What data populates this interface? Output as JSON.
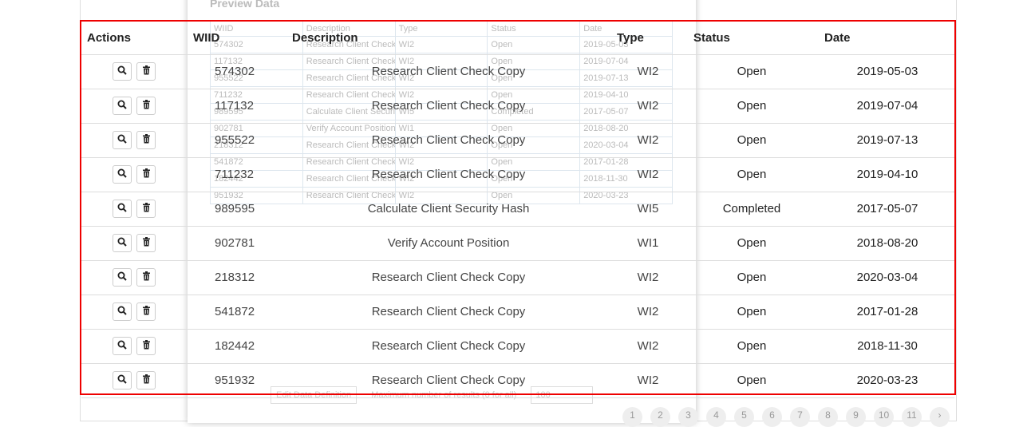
{
  "modal": {
    "title": "Preview Data",
    "columns": [
      "WIID",
      "Description",
      "Type",
      "Status",
      "Date"
    ],
    "rows": [
      [
        "574302",
        "Research Client Check Copy",
        "WI2",
        "Open",
        "2019-05-03"
      ],
      [
        "117132",
        "Research Client Check Copy",
        "WI2",
        "Open",
        "2019-07-04"
      ],
      [
        "955522",
        "Research Client Check Copy",
        "WI2",
        "Open",
        "2019-07-13"
      ],
      [
        "711232",
        "Research Client Check Copy",
        "WI2",
        "Open",
        "2019-04-10"
      ],
      [
        "989595",
        "Calculate Client Security Hash",
        "WI5",
        "Completed",
        "2017-05-07"
      ],
      [
        "902781",
        "Verify Account Position",
        "WI1",
        "Open",
        "2018-08-20"
      ],
      [
        "218312",
        "Research Client Check Copy",
        "WI2",
        "Open",
        "2020-03-04"
      ],
      [
        "541872",
        "Research Client Check Copy",
        "WI2",
        "Open",
        "2017-01-28"
      ],
      [
        "182442",
        "Research Client Check Copy",
        "WI2",
        "Open",
        "2018-11-30"
      ],
      [
        "951932",
        "Research Client Check Copy",
        "WI2",
        "Open",
        "2020-03-23"
      ]
    ],
    "edit_button": "Edit Data Definition",
    "max_label": "Maximum number of results (0 for all)",
    "max_value": "100"
  },
  "table": {
    "headers": [
      "Actions",
      "WIID",
      "Description",
      "Type",
      "Status",
      "Date"
    ],
    "rows": [
      [
        "574302",
        "Research Client Check Copy",
        "WI2",
        "Open",
        "2019-05-03"
      ],
      [
        "117132",
        "Research Client Check Copy",
        "WI2",
        "Open",
        "2019-07-04"
      ],
      [
        "955522",
        "Research Client Check Copy",
        "WI2",
        "Open",
        "2019-07-13"
      ],
      [
        "711232",
        "Research Client Check Copy",
        "WI2",
        "Open",
        "2019-04-10"
      ],
      [
        "989595",
        "Calculate Client Security Hash",
        "WI5",
        "Completed",
        "2017-05-07"
      ],
      [
        "902781",
        "Verify Account Position",
        "WI1",
        "Open",
        "2018-08-20"
      ],
      [
        "218312",
        "Research Client Check Copy",
        "WI2",
        "Open",
        "2020-03-04"
      ],
      [
        "541872",
        "Research Client Check Copy",
        "WI2",
        "Open",
        "2017-01-28"
      ],
      [
        "182442",
        "Research Client Check Copy",
        "WI2",
        "Open",
        "2018-11-30"
      ],
      [
        "951932",
        "Research Client Check Copy",
        "WI2",
        "Open",
        "2020-03-23"
      ]
    ]
  },
  "pagination": [
    "1",
    "2",
    "3",
    "4",
    "5",
    "6",
    "7",
    "8",
    "9",
    "10",
    "11",
    "›"
  ]
}
